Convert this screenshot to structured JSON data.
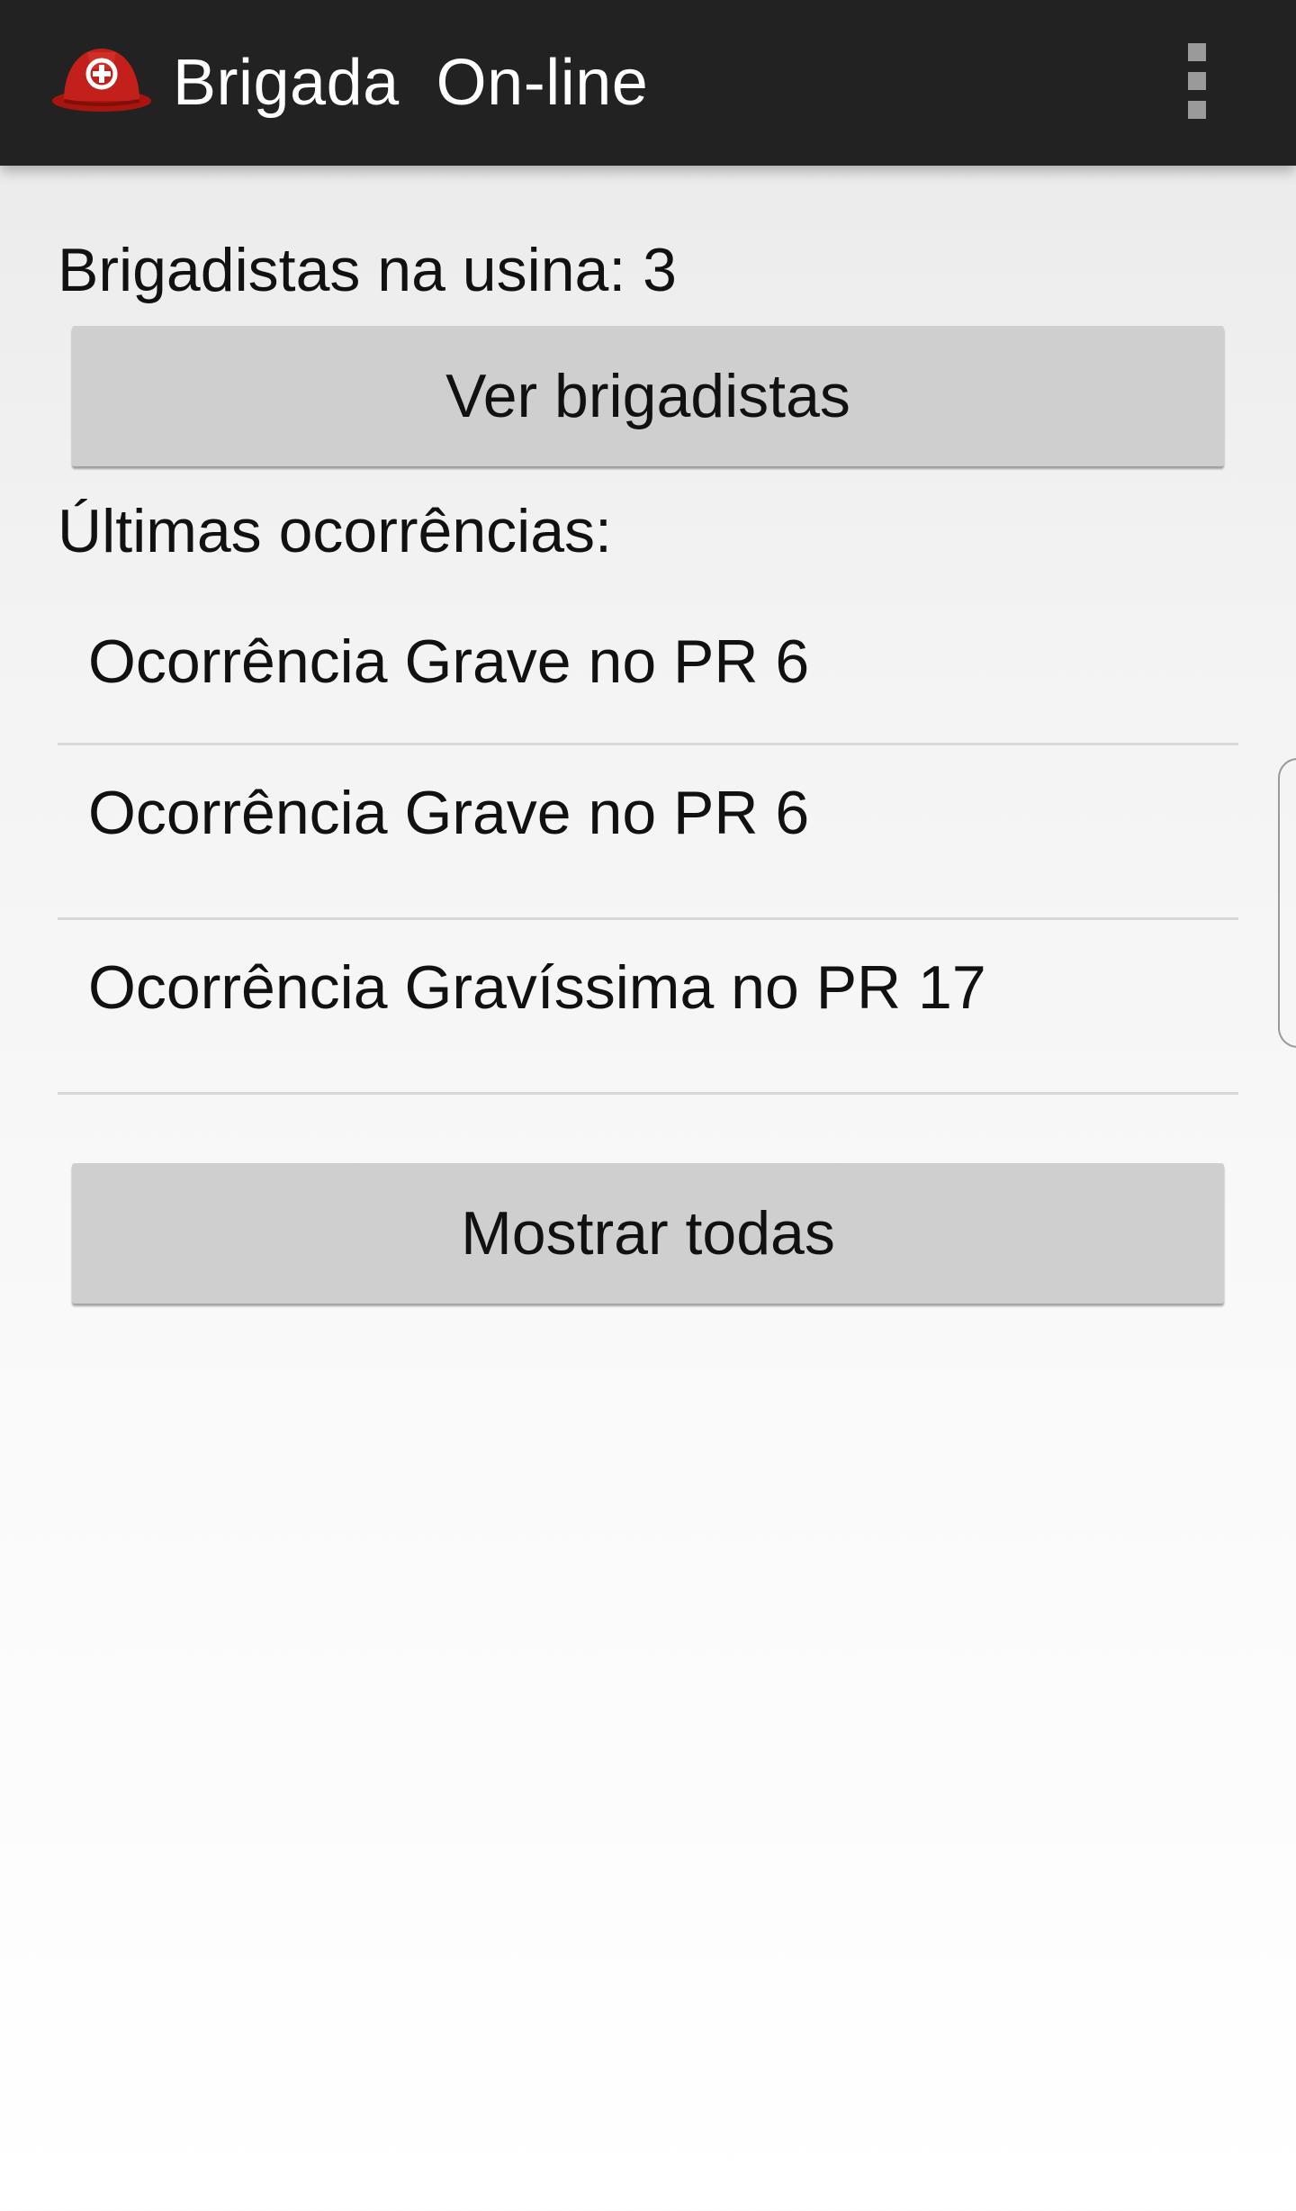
{
  "action_bar": {
    "app_icon": "red-helmet-icon",
    "title": "Brigada  On-line",
    "menu_icon": "overflow-menu-icon"
  },
  "brigadistas": {
    "label": "Brigadistas na usina: ",
    "count": "3",
    "button_label": "Ver brigadistas"
  },
  "ocorrencias": {
    "label": "Últimas ocorrências:",
    "items": [
      {
        "text": "Ocorrência Grave no PR 6"
      },
      {
        "text": "Ocorrência Grave no PR 6"
      },
      {
        "text": "Ocorrência Gravíssima no PR 17"
      }
    ],
    "show_all_label": "Mostrar todas"
  },
  "colors": {
    "action_bar_bg": "#222222",
    "helmet_red": "#c3201b",
    "button_bg": "#cfcfcf"
  }
}
